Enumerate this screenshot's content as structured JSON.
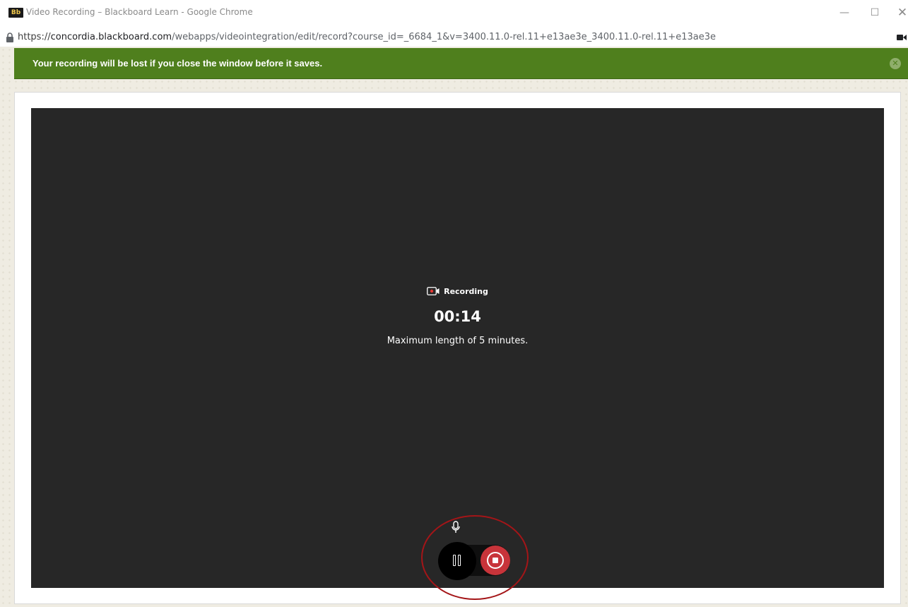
{
  "window": {
    "logo_text": "Bb",
    "title": "Video Recording – Blackboard Learn - Google Chrome",
    "minimize_glyph": "—",
    "maximize_glyph": "☐",
    "close_glyph": "✕"
  },
  "address_bar": {
    "url_scheme": "https://",
    "url_host": "concordia.blackboard.com",
    "url_path": "/webapps/videointegration/edit/record?course_id=_6684_1&v=3400.11.0-rel.11+e13ae3e_3400.11.0-rel.11+e13ae3e"
  },
  "notice": {
    "message": "Your recording will be lost if you close the window before it saves.",
    "close_glyph": "✕",
    "background_color": "#4f7f1d"
  },
  "recorder": {
    "status_label": "Recording",
    "timer": "00:14",
    "max_length_text": "Maximum length of 5 minutes.",
    "icons": [
      "record-video-icon",
      "microphone-icon",
      "pause-icon",
      "stop-icon"
    ],
    "stop_color": "#c8343a",
    "highlight_color": "#a41518"
  }
}
